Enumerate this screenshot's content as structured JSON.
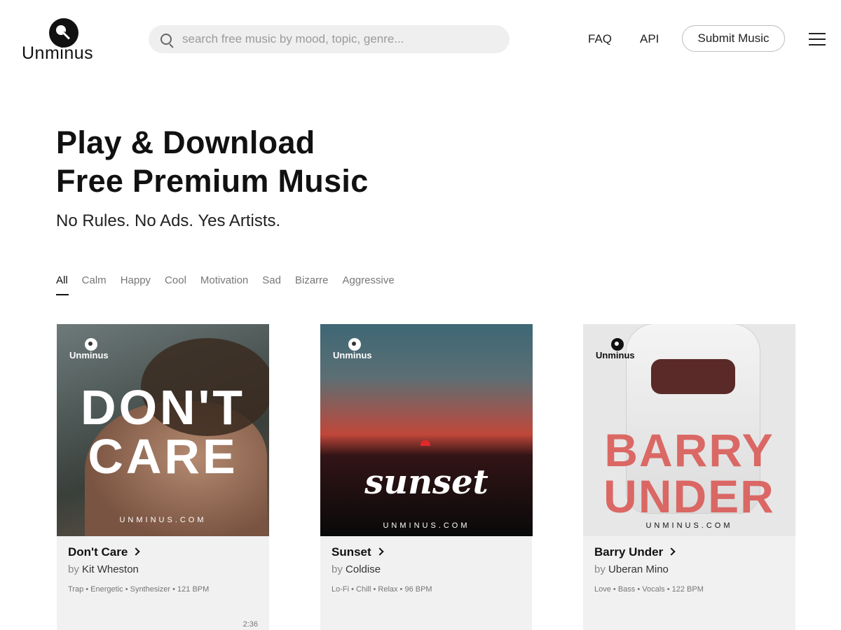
{
  "header": {
    "logo_text": "Unminus",
    "search_placeholder": "search free music by mood, topic, genre...",
    "nav": {
      "faq": "FAQ",
      "api": "API",
      "submit": "Submit Music"
    }
  },
  "hero": {
    "title_line1": "Play & Download",
    "title_line2": "Free Premium Music",
    "subtitle": "No Rules. No Ads. Yes Artists."
  },
  "filters": [
    "All",
    "Calm",
    "Happy",
    "Cool",
    "Motivation",
    "Sad",
    "Bizarre",
    "Aggressive"
  ],
  "active_filter": "All",
  "tracks": [
    {
      "title": "Don't Care",
      "by": "by",
      "artist": "Kit Wheston",
      "tags": "Trap • Energetic • Synthesizer • 121 BPM",
      "duration": "2:36",
      "cover_brand": "Unminus",
      "cover_line1": "DON'T",
      "cover_line2": "CARE",
      "cover_site": "UNMINUS.COM"
    },
    {
      "title": "Sunset",
      "by": "by",
      "artist": "Coldise",
      "tags": "Lo-Fi • Chill • Relax • 96 BPM",
      "cover_brand": "Unminus",
      "cover_word": "sunset",
      "cover_site": "UNMINUS.COM"
    },
    {
      "title": "Barry Under",
      "by": "by",
      "artist": "Uberan Mino",
      "tags": "Love • Bass • Vocals • 122 BPM",
      "cover_brand": "Unminus",
      "cover_line1": "BARRY",
      "cover_line2": "UNDER",
      "cover_site": "UNMINUS.COM"
    }
  ]
}
